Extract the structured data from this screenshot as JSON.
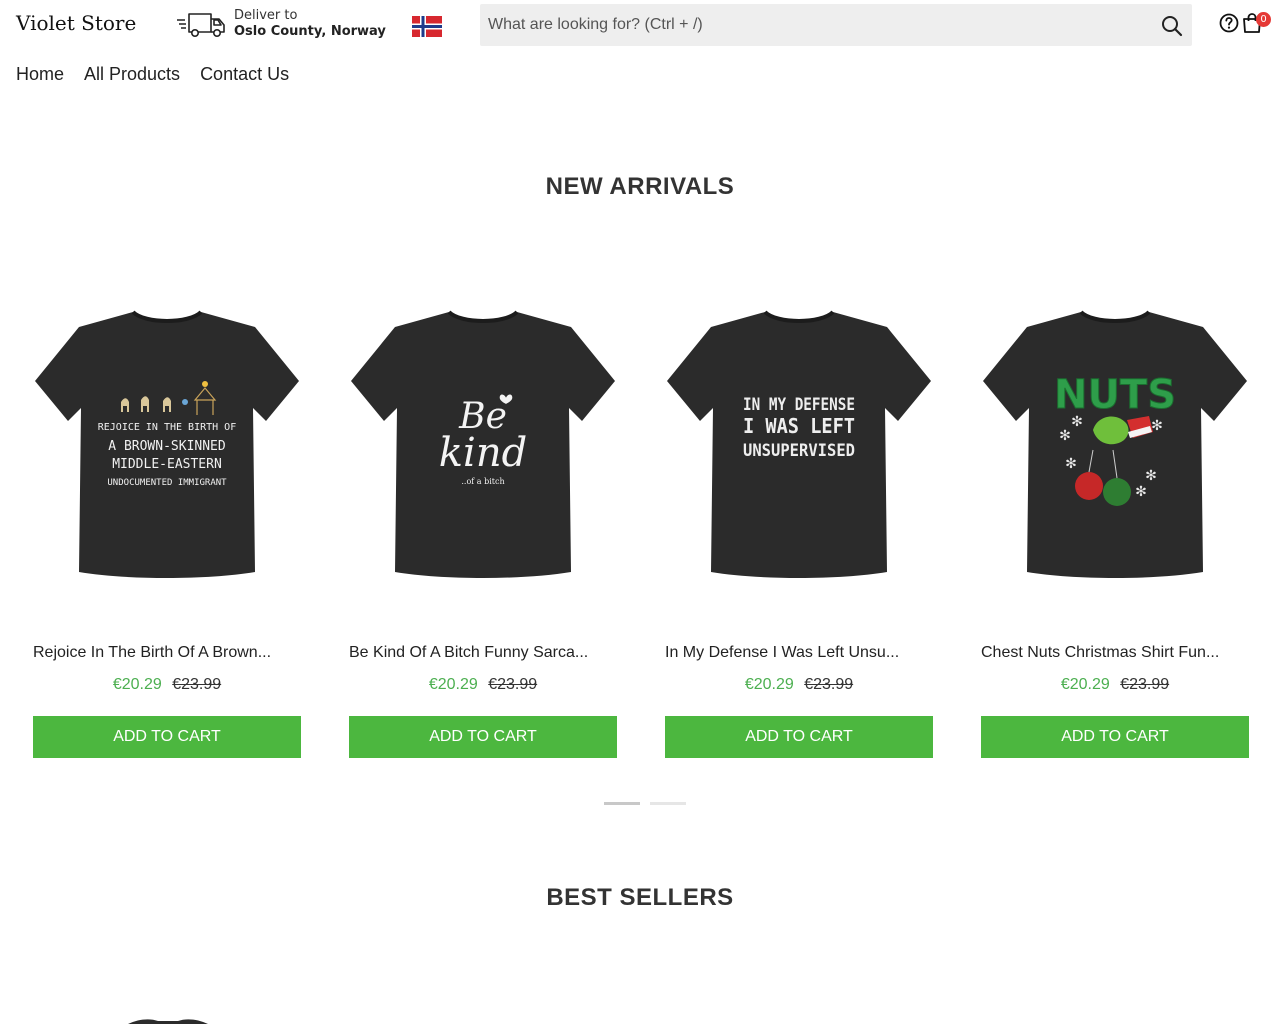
{
  "header": {
    "logo": "Violet Store",
    "deliver_label": "Deliver to",
    "deliver_location": "Oslo County, Norway",
    "flag": "norway-flag",
    "search_placeholder": "What are looking for? (Ctrl + /)",
    "cart_count": "0"
  },
  "nav": {
    "items": [
      "Home",
      "All Products",
      "Contact Us"
    ]
  },
  "sections": {
    "new_arrivals": "NEW ARRIVALS",
    "best_sellers": "BEST SELLERS"
  },
  "products": [
    {
      "name": "Rejoice In The Birth Of A Brown...",
      "price": "€20.29",
      "old_price": "€23.99",
      "button": "ADD TO CART",
      "shirt_text": [
        "REJOICE IN THE BIRTH OF",
        "A BROWN-SKINNED",
        "MIDDLE-EASTERN",
        "UNDOCUMENTED IMMIGRANT"
      ]
    },
    {
      "name": "Be Kind Of A Bitch Funny Sarca...",
      "price": "€20.29",
      "old_price": "€23.99",
      "button": "ADD TO CART",
      "shirt_text": [
        "Be",
        "kind",
        "..of a bitch"
      ]
    },
    {
      "name": "In My Defense I Was Left Unsu...",
      "price": "€20.29",
      "old_price": "€23.99",
      "button": "ADD TO CART",
      "shirt_text": [
        "IN MY DEFENSE",
        "I WAS LEFT",
        "UNSUPERVISED"
      ]
    },
    {
      "name": "Chest Nuts Christmas Shirt Fun...",
      "price": "€20.29",
      "old_price": "€23.99",
      "button": "ADD TO CART",
      "shirt_text": [
        "NUTS"
      ]
    }
  ],
  "carousel": {
    "pages": 2,
    "active": 1
  },
  "colors": {
    "accent_green": "#4cb73f",
    "price_green": "#4caf50",
    "badge_red": "#e53935",
    "shirt": "#2b2b2b"
  }
}
